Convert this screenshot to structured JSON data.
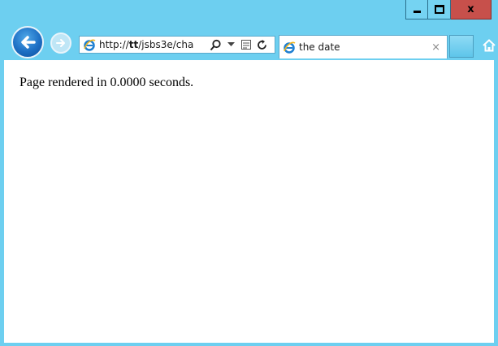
{
  "window": {
    "accent_color": "#6dcff0",
    "close_color": "#c7504b",
    "buttons": {
      "minimize_icon": "minimize-icon",
      "maximize_icon": "maximize-icon",
      "close_label": "x"
    }
  },
  "nav": {
    "back_icon": "back-arrow-icon",
    "forward_icon": "forward-arrow-icon",
    "address": {
      "prefix": "http://",
      "host": "tt",
      "path": "/jsbs3e/cha",
      "tools": [
        "search-icon",
        "dropdown-icon",
        "compatibility-view-icon",
        "refresh-icon"
      ]
    },
    "home_icon": "home-icon"
  },
  "tabs": [
    {
      "title": "the date",
      "close_label": "×",
      "icon": "ie-icon",
      "active": true
    }
  ],
  "page": {
    "text": "Page rendered in 0.0000 seconds."
  }
}
